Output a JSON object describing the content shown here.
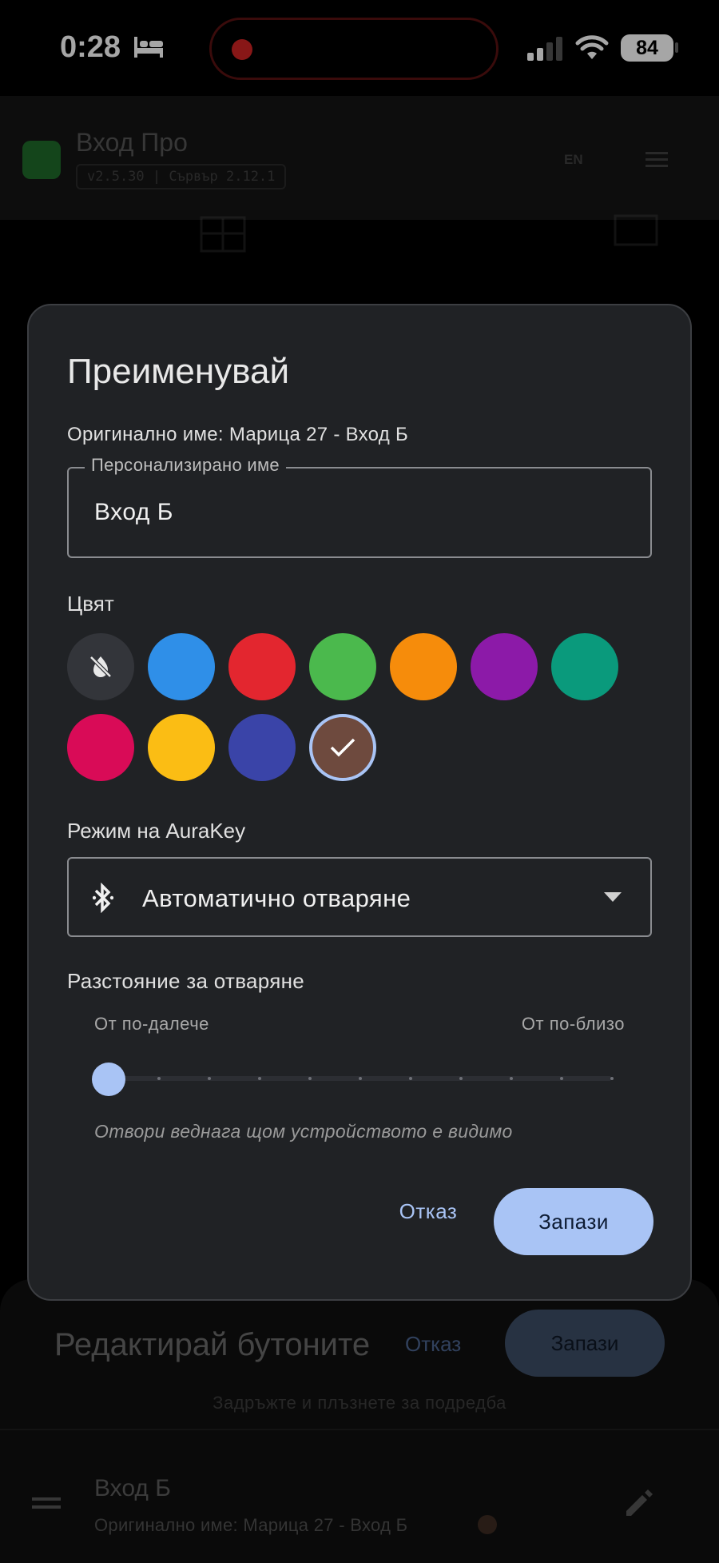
{
  "status_bar": {
    "time": "0:28",
    "battery": "84",
    "icons": [
      "bed-icon",
      "signal-icon",
      "wifi-icon",
      "battery-icon"
    ]
  },
  "app": {
    "title": "Вход Про",
    "version": "v2.5.30 | Сървър 2.12.1",
    "lang": "EN",
    "icons": [
      "lock-logo-icon",
      "menu-icon"
    ]
  },
  "dialog": {
    "title": "Преименувай",
    "original_name": "Оригинално име: Марица 27 - Вход Б",
    "custom_name_label": "Персонализирано име",
    "custom_name_value": "Вход Б",
    "color_label": "Цвят",
    "colors": [
      {
        "name": "none",
        "hex": "#33353a"
      },
      {
        "name": "blue",
        "hex": "#2f8fe8"
      },
      {
        "name": "red",
        "hex": "#e3262f"
      },
      {
        "name": "green",
        "hex": "#4bb94d"
      },
      {
        "name": "orange",
        "hex": "#f68c0b"
      },
      {
        "name": "purple",
        "hex": "#8c1aa8"
      },
      {
        "name": "teal",
        "hex": "#0a9a7c"
      },
      {
        "name": "pink",
        "hex": "#d90b57"
      },
      {
        "name": "yellow",
        "hex": "#fbbd14"
      },
      {
        "name": "indigo",
        "hex": "#3a44a8"
      },
      {
        "name": "brown",
        "hex": "#6e4a3e"
      }
    ],
    "selected_color": "brown",
    "mode_label": "Режим на AuraKey",
    "mode_value": "Автоматично отваряне",
    "distance_label": "Разстояние за отваряне",
    "distance_far": "От по-далече",
    "distance_near": "От по-близо",
    "distance_level": 0,
    "distance_steps": 10,
    "distance_hint": "Отвори веднага щом устройството е видимо",
    "cancel": "Отказ",
    "save": "Запази"
  },
  "edit_panel": {
    "title": "Редактирай бутоните",
    "cancel": "Отказ",
    "save": "Запази",
    "hint": "Задръжте и плъзнете за подредба",
    "row": {
      "title": "Вход Б",
      "subtitle": "Оригинално име: Марица 27 - Вход Б",
      "dot_color": "#3e2c22"
    }
  }
}
